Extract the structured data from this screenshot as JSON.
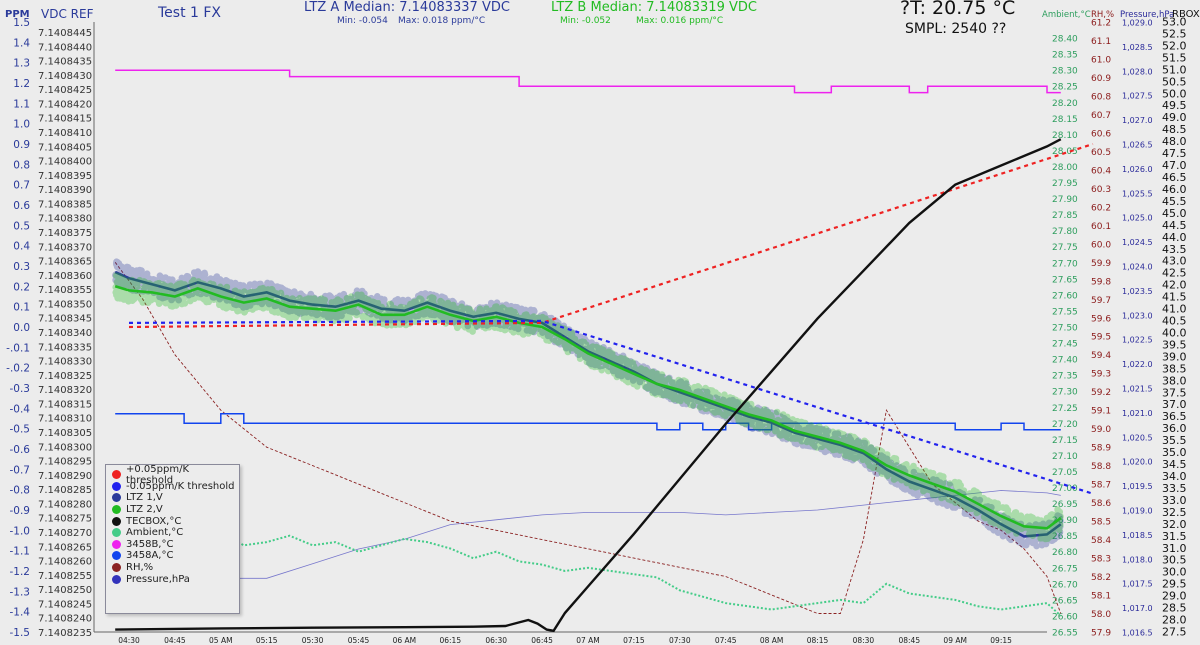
{
  "header": {
    "ppm_axis_label": "PPM",
    "vdc_axis_label": "VDC REF",
    "test_name": "Test 1 FX",
    "ltz_a_title": "LTZ A Median: 7.14083337 VDC",
    "ltz_a_min": "Min: -0.054",
    "ltz_a_max": "Max: 0.018 ppm/°C",
    "ltz_b_title": "LTZ B Median: 7.14083319 VDC",
    "ltz_b_min": "Min: -0.052",
    "ltz_b_max": "Max: 0.016 ppm/°C",
    "temp_readout": "?T: 20.75 °C",
    "sample_readout": "SMPL: 2540 ??",
    "ambient_axis_label": "Ambient,°C",
    "rh_axis_label": "RH,%",
    "pressure_axis_label": "Pressure,hPa",
    "rbox_axis_label": "RBOX"
  },
  "legend": [
    {
      "label": "+0.05ppm/K threshold",
      "color": "#ee2222"
    },
    {
      "label": "-0.05ppm/K threshold",
      "color": "#2222ee"
    },
    {
      "label": "LTZ 1,V",
      "color": "#2a3a9a"
    },
    {
      "label": "LTZ 2,V",
      "color": "#22bb22"
    },
    {
      "label": "TECBOX,°C",
      "color": "#111111"
    },
    {
      "label": "Ambient,°C",
      "color": "#44cc88"
    },
    {
      "label": "3458B,°C",
      "color": "#ee22ee"
    },
    {
      "label": "3458A,°C",
      "color": "#1144ee"
    },
    {
      "label": "RH,%",
      "color": "#8b2222"
    },
    {
      "label": "Pressure,hPa",
      "color": "#3333bb"
    }
  ],
  "colors": {
    "ppm_axis": "#2a3a9a",
    "ambient_axis": "#2e9e5e",
    "rh_axis": "#8b1a1a",
    "pressure_axis": "#2a2a9a",
    "rbox_axis": "#111111",
    "ltz_a_title": "#2a3a9a",
    "ltz_b_title": "#22bb22"
  },
  "chart_data": {
    "type": "line",
    "x_ticks": [
      "04:30",
      "04:45",
      "05 AM",
      "05:15",
      "05:30",
      "05:45",
      "06 AM",
      "06:15",
      "06:30",
      "06:45",
      "07 AM",
      "07:15",
      "07:30",
      "07:45",
      "08 AM",
      "08:15",
      "08:30",
      "08:45",
      "09 AM",
      "09:15"
    ],
    "ppm_axis": {
      "min": -1.5,
      "max": 1.5,
      "step": 0.1
    },
    "ppm_ticks": [
      "1.5",
      "1.4",
      "1.3",
      "1.2",
      "1.1",
      "1.0",
      "0.9",
      "0.8",
      "0.7",
      "0.6",
      "0.5",
      "0.4",
      "0.3",
      "0.2",
      "0.1",
      "0.0",
      "-.0.1",
      "-.0.2",
      "-0.3",
      "-0.4",
      "-0.5",
      "-0.6",
      "-0.7",
      "-0.8",
      "-0.9",
      "-1.0",
      "-1.1",
      "-1.2",
      "-1.3",
      "-1.4",
      "-1.5"
    ],
    "vdc_ticks": [
      "7.1408445",
      "7.1408440",
      "7.1408435",
      "7.1408430",
      "7.1408425",
      "7.1408420",
      "7.1408415",
      "7.1408410",
      "7.1408405",
      "7.1408400",
      "7.1408395",
      "7.1408390",
      "7.1408385",
      "7.1408380",
      "7.1408375",
      "7.1408370",
      "7.1408365",
      "7.1408360",
      "7.1408355",
      "7.1408350",
      "7.1408345",
      "7.1408340",
      "7.1408335",
      "7.1408330",
      "7.1408325",
      "7.1408320",
      "7.1408315",
      "7.1408310",
      "7.1408305",
      "7.1408300",
      "7.1408295",
      "7.1408290",
      "7.1408285",
      "7.1408280",
      "7.1408275",
      "7.1408270",
      "7.1408265",
      "7.1408260",
      "7.1408255",
      "7.1408250",
      "7.1408245",
      "7.1408240",
      "7.1408235"
    ],
    "ambient_axis": {
      "min": 26.55,
      "max": 28.45,
      "step": 0.05
    },
    "ambient_ticks": [
      "28.40",
      "28.35",
      "28.30",
      "28.25",
      "28.20",
      "28.15",
      "28.10",
      "28.05",
      "28.00",
      "27.95",
      "27.90",
      "27.85",
      "27.80",
      "27.75",
      "27.70",
      "27.65",
      "27.60",
      "27.55",
      "27.50",
      "27.45",
      "27.40",
      "27.35",
      "27.30",
      "27.25",
      "27.20",
      "27.15",
      "27.10",
      "27.05",
      "27.00",
      "26.95",
      "26.90",
      "26.85",
      "26.80",
      "26.75",
      "26.70",
      "26.65",
      "26.60",
      "26.55"
    ],
    "rh_axis": {
      "min": 57.9,
      "max": 61.2,
      "step": 0.1
    },
    "rh_ticks": [
      "61.2",
      "61.1",
      "61.0",
      "60.9",
      "60.8",
      "60.7",
      "60.6",
      "60.5",
      "60.4",
      "60.3",
      "60.2",
      "60.1",
      "60.0",
      "59.9",
      "59.8",
      "59.7",
      "59.6",
      "59.5",
      "59.4",
      "59.3",
      "59.2",
      "59.1",
      "59.0",
      "58.9",
      "58.8",
      "58.7",
      "58.6",
      "58.5",
      "58.4",
      "58.3",
      "58.2",
      "58.1",
      "58.0",
      "57.9"
    ],
    "pressure_axis": {
      "min": 1016.5,
      "max": 1029.0,
      "step": 0.5
    },
    "pressure_ticks": [
      "1,029.0",
      "1,028.5",
      "1,028.0",
      "1,027.5",
      "1,027.0",
      "1,026.5",
      "1,026.0",
      "1,025.5",
      "1,025.0",
      "1,024.5",
      "1,024.0",
      "1,023.5",
      "1,023.0",
      "1,022.5",
      "1,022.0",
      "1,021.5",
      "1,021.0",
      "1,020.5",
      "1,020.0",
      "1,019.5",
      "1,019.0",
      "1,018.5",
      "1,018.0",
      "1,017.5",
      "1,017.0",
      "1,016.5"
    ],
    "rbox_axis": {
      "min": 27.5,
      "max": 53.0,
      "step": 0.5
    },
    "rbox_ticks": [
      "53.0",
      "52.5",
      "52.0",
      "51.5",
      "51.0",
      "50.5",
      "50.0",
      "49.5",
      "49.0",
      "48.5",
      "48.0",
      "47.5",
      "47.0",
      "46.5",
      "46.0",
      "45.5",
      "45.0",
      "44.5",
      "44.0",
      "43.5",
      "43.0",
      "42.5",
      "42.0",
      "41.5",
      "41.0",
      "40.5",
      "40.0",
      "39.5",
      "39.0",
      "38.5",
      "38.0",
      "37.5",
      "37.0",
      "36.5",
      "36.0",
      "35.5",
      "35.0",
      "34.5",
      "34.0",
      "33.5",
      "33.0",
      "32.5",
      "32.0",
      "31.5",
      "31.0",
      "30.5",
      "30.0",
      "29.5",
      "29.0",
      "28.5",
      "28.0",
      "27.5"
    ],
    "series": [
      {
        "name": "+0.05ppm/K threshold",
        "axis": "ppm",
        "style": "dashed",
        "color": "#ee2222",
        "x": [
          0.0,
          9.0,
          21.0
        ],
        "y": [
          0.0,
          0.02,
          0.9
        ]
      },
      {
        "name": "-0.05ppm/K threshold",
        "axis": "ppm",
        "style": "dashed",
        "color": "#2222ee",
        "x": [
          0.0,
          9.0,
          21.0
        ],
        "y": [
          0.02,
          0.03,
          -0.82
        ]
      },
      {
        "name": "LTZ 1,V",
        "axis": "ppm",
        "style": "scatter-line",
        "color": "#2a3a9a",
        "x": [
          -0.3,
          0.0,
          0.5,
          1.0,
          1.5,
          2.0,
          2.5,
          3.0,
          3.5,
          4.0,
          4.5,
          5.0,
          5.5,
          6.0,
          6.5,
          7.0,
          7.5,
          8.0,
          8.5,
          9.0,
          9.5,
          10.0,
          10.5,
          11.0,
          11.5,
          12.0,
          12.5,
          13.0,
          13.5,
          14.0,
          14.5,
          15.0,
          15.5,
          16.0,
          16.5,
          17.0,
          17.5,
          18.0,
          18.5,
          19.0,
          19.5,
          20.0,
          20.3
        ],
        "y": [
          0.27,
          0.24,
          0.21,
          0.18,
          0.22,
          0.19,
          0.15,
          0.17,
          0.13,
          0.11,
          0.1,
          0.13,
          0.09,
          0.08,
          0.12,
          0.08,
          0.05,
          0.07,
          0.04,
          0.02,
          -0.05,
          -0.12,
          -0.17,
          -0.22,
          -0.28,
          -0.32,
          -0.36,
          -0.4,
          -0.44,
          -0.47,
          -0.52,
          -0.55,
          -0.58,
          -0.62,
          -0.7,
          -0.76,
          -0.8,
          -0.84,
          -0.9,
          -0.97,
          -1.03,
          -1.02,
          -0.97
        ]
      },
      {
        "name": "LTZ 2,V",
        "axis": "ppm",
        "style": "scatter-line",
        "color": "#22bb22",
        "x": [
          -0.3,
          0.0,
          0.5,
          1.0,
          1.5,
          2.0,
          2.5,
          3.0,
          3.5,
          4.0,
          4.5,
          5.0,
          5.5,
          6.0,
          6.5,
          7.0,
          7.5,
          8.0,
          8.5,
          9.0,
          9.5,
          10.0,
          10.5,
          11.0,
          11.5,
          12.0,
          12.5,
          13.0,
          13.5,
          14.0,
          14.5,
          15.0,
          15.5,
          16.0,
          16.5,
          17.0,
          17.5,
          18.0,
          18.5,
          19.0,
          19.5,
          20.0,
          20.3
        ],
        "y": [
          0.2,
          0.18,
          0.17,
          0.15,
          0.19,
          0.15,
          0.12,
          0.14,
          0.1,
          0.09,
          0.08,
          0.11,
          0.06,
          0.06,
          0.1,
          0.06,
          0.03,
          0.05,
          0.02,
          0.0,
          -0.06,
          -0.13,
          -0.18,
          -0.23,
          -0.28,
          -0.31,
          -0.35,
          -0.39,
          -0.43,
          -0.46,
          -0.51,
          -0.54,
          -0.57,
          -0.61,
          -0.68,
          -0.73,
          -0.77,
          -0.81,
          -0.87,
          -0.93,
          -0.98,
          -0.99,
          -0.94
        ]
      },
      {
        "name": "TECBOX,°C",
        "axis": "rbox",
        "style": "line",
        "color": "#111111",
        "x": [
          -0.3,
          2.0,
          4.0,
          6.0,
          7.5,
          8.2,
          8.5,
          8.7,
          8.9,
          9.1,
          9.25,
          9.5,
          10.0,
          11.0,
          12.0,
          13.0,
          14.0,
          15.0,
          16.0,
          17.0,
          18.0,
          19.0,
          20.0,
          20.3
        ],
        "y": [
          27.6,
          27.65,
          27.68,
          27.7,
          27.72,
          27.75,
          27.9,
          28.0,
          27.85,
          27.6,
          27.55,
          28.3,
          29.4,
          31.6,
          33.9,
          36.2,
          38.4,
          40.6,
          42.6,
          44.6,
          46.2,
          47.0,
          47.8,
          48.1
        ]
      },
      {
        "name": "Ambient,°C",
        "axis": "ambient",
        "style": "dotted",
        "color": "#44cc88",
        "x": [
          -0.3,
          0.5,
          1.0,
          1.5,
          2.0,
          2.5,
          3.0,
          3.5,
          4.0,
          4.5,
          5.0,
          5.5,
          6.0,
          6.5,
          7.0,
          7.5,
          8.0,
          8.5,
          9.0,
          9.5,
          10.0,
          10.5,
          11.0,
          11.5,
          12.0,
          12.5,
          13.0,
          13.5,
          14.0,
          14.5,
          15.0,
          15.5,
          16.0,
          16.5,
          17.0,
          17.5,
          18.0,
          18.5,
          19.0,
          19.5,
          20.0,
          20.3
        ],
        "y": [
          26.93,
          26.91,
          26.88,
          26.84,
          26.86,
          26.82,
          26.83,
          26.85,
          26.82,
          26.83,
          26.8,
          26.82,
          26.84,
          26.83,
          26.81,
          26.78,
          26.8,
          26.77,
          26.76,
          26.74,
          26.75,
          26.74,
          26.73,
          26.72,
          26.68,
          26.66,
          26.64,
          26.63,
          26.62,
          26.63,
          26.64,
          26.65,
          26.64,
          26.7,
          26.67,
          26.66,
          26.65,
          26.63,
          26.62,
          26.63,
          26.64,
          26.6
        ]
      },
      {
        "name": "3458B,°C",
        "axis": "ambient",
        "style": "step",
        "color": "#ee22ee",
        "x": [
          -0.3,
          3.5,
          3.5,
          8.5,
          8.5,
          14.5,
          14.5,
          15.3,
          15.3,
          17.0,
          17.0,
          17.4,
          17.4,
          20.0,
          20.0,
          20.3
        ],
        "y": [
          28.3,
          28.3,
          28.28,
          28.28,
          28.25,
          28.25,
          28.23,
          28.23,
          28.25,
          28.25,
          28.23,
          28.23,
          28.25,
          28.25,
          28.23,
          28.23
        ]
      },
      {
        "name": "3458A,°C",
        "axis": "ambient",
        "style": "step",
        "color": "#1144ee",
        "x": [
          -0.3,
          1.2,
          1.2,
          2.0,
          2.0,
          2.5,
          2.5,
          11.5,
          11.5,
          12.0,
          12.0,
          12.5,
          12.5,
          13.0,
          13.0,
          13.5,
          13.5,
          14.0,
          14.0,
          18.0,
          18.0,
          19.0,
          19.0,
          19.5,
          19.5,
          20.3
        ],
        "y": [
          27.23,
          27.23,
          27.2,
          27.2,
          27.23,
          27.23,
          27.2,
          27.2,
          27.18,
          27.18,
          27.2,
          27.2,
          27.18,
          27.18,
          27.2,
          27.2,
          27.18,
          27.18,
          27.2,
          27.2,
          27.18,
          27.18,
          27.2,
          27.2,
          27.18,
          27.18
        ]
      },
      {
        "name": "RH,%",
        "axis": "rh",
        "style": "dashed-thin",
        "color": "#8b2222",
        "x": [
          -0.3,
          0.3,
          1.0,
          2.0,
          3.0,
          4.0,
          5.0,
          6.0,
          7.0,
          8.0,
          9.0,
          10.0,
          11.0,
          12.0,
          13.0,
          14.0,
          15.0,
          15.5,
          16.0,
          16.5,
          17.0,
          17.5,
          18.0,
          18.5,
          19.0,
          19.5,
          20.0,
          20.3
        ],
        "y": [
          59.9,
          59.7,
          59.4,
          59.1,
          58.9,
          58.8,
          58.7,
          58.6,
          58.5,
          58.45,
          58.4,
          58.35,
          58.3,
          58.25,
          58.2,
          58.1,
          58.0,
          58.0,
          58.4,
          59.1,
          58.9,
          58.7,
          58.6,
          58.5,
          58.45,
          58.35,
          58.2,
          58.0
        ]
      },
      {
        "name": "Pressure,hPa",
        "axis": "pressure",
        "style": "line-thin",
        "color": "#7777cc",
        "x": [
          -0.3,
          1.0,
          2.0,
          3.0,
          4.0,
          5.0,
          6.0,
          7.0,
          8.0,
          9.0,
          10.0,
          11.0,
          12.0,
          13.0,
          14.0,
          15.0,
          16.0,
          17.0,
          18.0,
          19.0,
          20.0,
          20.3
        ],
        "y": [
          1018.4,
          1018.0,
          1017.6,
          1017.6,
          1017.9,
          1018.2,
          1018.4,
          1018.7,
          1018.8,
          1018.9,
          1018.95,
          1018.95,
          1018.95,
          1018.9,
          1018.95,
          1019.0,
          1019.1,
          1019.2,
          1019.3,
          1019.4,
          1019.35,
          1019.3
        ]
      }
    ]
  }
}
